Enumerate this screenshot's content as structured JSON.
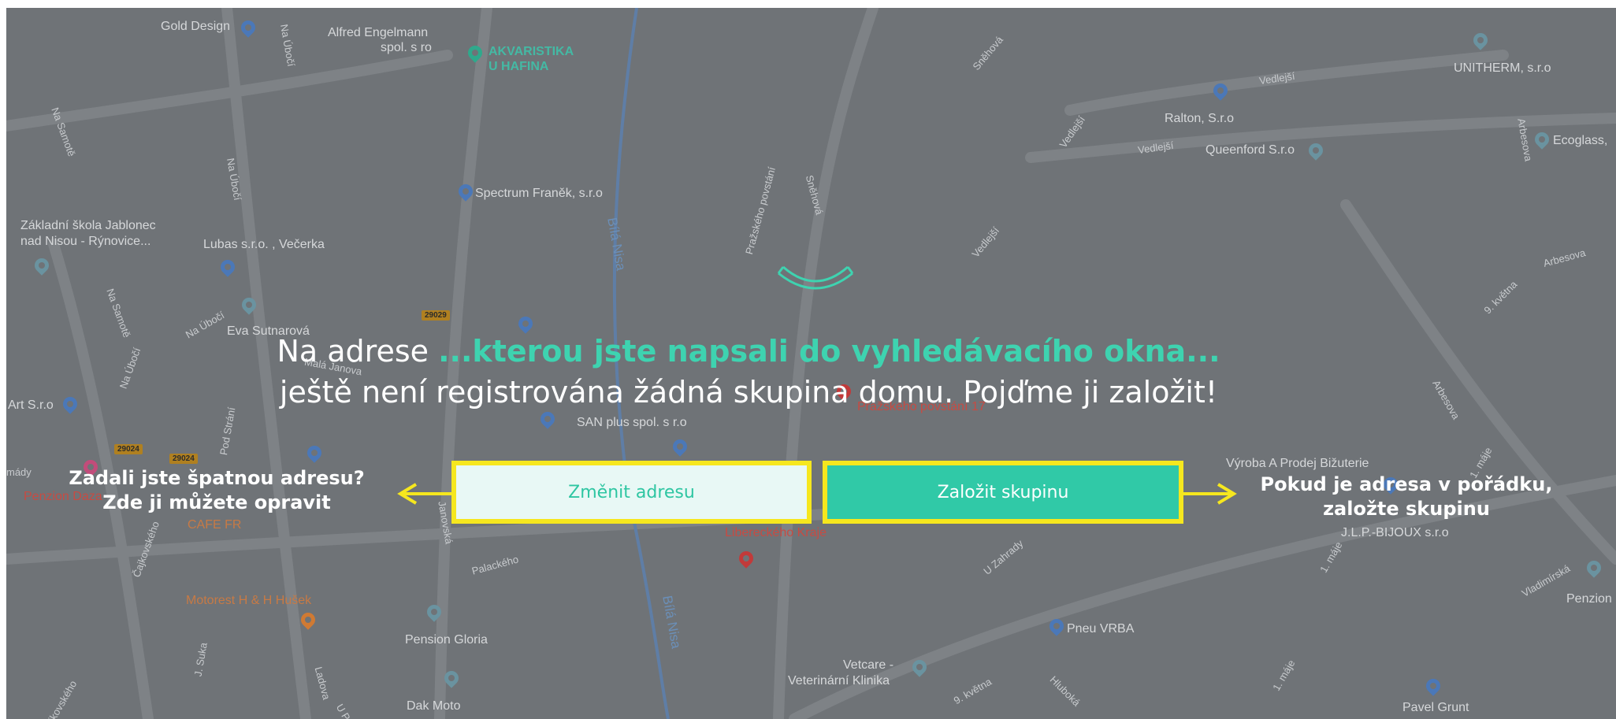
{
  "headline": {
    "before": "Na adrese",
    "highlight": "...kterou jste napsali do vyhledávacího okna...",
    "after": "ještě není registrována žádná skupina domu. Pojďme ji založit!"
  },
  "buttons": {
    "change_address": "Změnit adresu",
    "create_group": "Založit skupinu"
  },
  "notes": {
    "left_line1": "Zadali jste špatnou adresu?",
    "left_line2": "Zde ji můžete opravit",
    "right_line1": "Pokud je adresa v pořádku,",
    "right_line2": "založte skupinu"
  },
  "colors": {
    "accent": "#30c9a7",
    "highlight_border": "#f6e71e",
    "overlay": "#6f7377"
  },
  "map": {
    "places": {
      "gold_design": "Gold Design",
      "alfred_1": "Alfred Engelmann",
      "alfred_2": "spol. s ro",
      "akvaristika_1": "AKVARISTIKA",
      "akvaristika_2": "U HAFINA",
      "unitherm": "UNITHERM, s.r.o",
      "ralton": "Ralton, S.r.o",
      "queenford": "Queenford S.r.o",
      "ecoglass": "Ecoglass,",
      "spectrum": "Spectrum Franěk, s.r.o",
      "zakladni_1": "Základní škola Jablonec",
      "zakladni_2": "nad Nisou - Rýnovice...",
      "lubas": "Lubas s.r.o. , Večerka",
      "eva": "Eva Sutnarová",
      "art": "Art S.r.o",
      "san_plus": "SAN plus spol. s r.o",
      "prazskeho_pin": "Pražského povstání 17",
      "penzion_daza": "Penzion Daza",
      "cafe_fr": "CAFE FR",
      "liberecky_1": "Libereckého Kraje",
      "vyroba": "Výroba A Prodej Bižuterie",
      "jlp": "J.L.P.-BIJOUX s.r.o",
      "motorest": "Motorest H & H Hušek",
      "pension_gloria": "Pension Gloria",
      "pneu_vrba": "Pneu VRBA",
      "vetcare_1": "Vetcare -",
      "vetcare_2": "Veterinární Klinika",
      "dak_moto": "Dak Moto",
      "pavel_grunt": "Pavel Grunt",
      "penzion_r": "Penzion"
    },
    "streets": {
      "na_uboci_1": "Na Úbočí",
      "na_samote_1": "Na Samotě",
      "na_uboci_2": "Na Úbočí",
      "na_samote_2": "Na Samotě",
      "na_uboci_3": "Na Úbočí",
      "na_uboci_4": "Na Úbočí",
      "mala_janova": "Malá Janova",
      "pod_strani": "Pod Strání",
      "mady": "mády",
      "cajkovskeho_1": "Čajkovského",
      "janovska": "Janovská",
      "palackeho": "Palackého",
      "bila_nisa_1": "Bílá Nisa",
      "bila_nisa_2": "Bílá Nisa",
      "prazskeho": "Pražského povstání",
      "snezna": "Sněhová",
      "snehova_2": "Sněhová",
      "vedlejsi_1": "Vedlejší",
      "vedlejsi_2": "Vedlejší",
      "vedlejsi_3": "Vedlejší",
      "vedlejsi_4": "Vedlejší",
      "arbesova_1": "Arbesova",
      "arbesova_2": "Arbesova",
      "arbesova_3": "Arbesova",
      "kvetna_1": "9. května",
      "kvetna_2": "9. května",
      "maje_1": "1. máje",
      "maje_2": "1. máje",
      "maje_3": "1. máje",
      "vladimirska": "Vladimírská",
      "hlubok": "Hluboká",
      "u_zahrady": "U Zahrady",
      "j_suka": "J. Suka",
      "ladova": "Ladova",
      "u_po": "U Po",
      "cajkovskeho_2": "Čajkovského",
      "route1": "29029",
      "route2": "29024",
      "route3": "29024"
    }
  }
}
